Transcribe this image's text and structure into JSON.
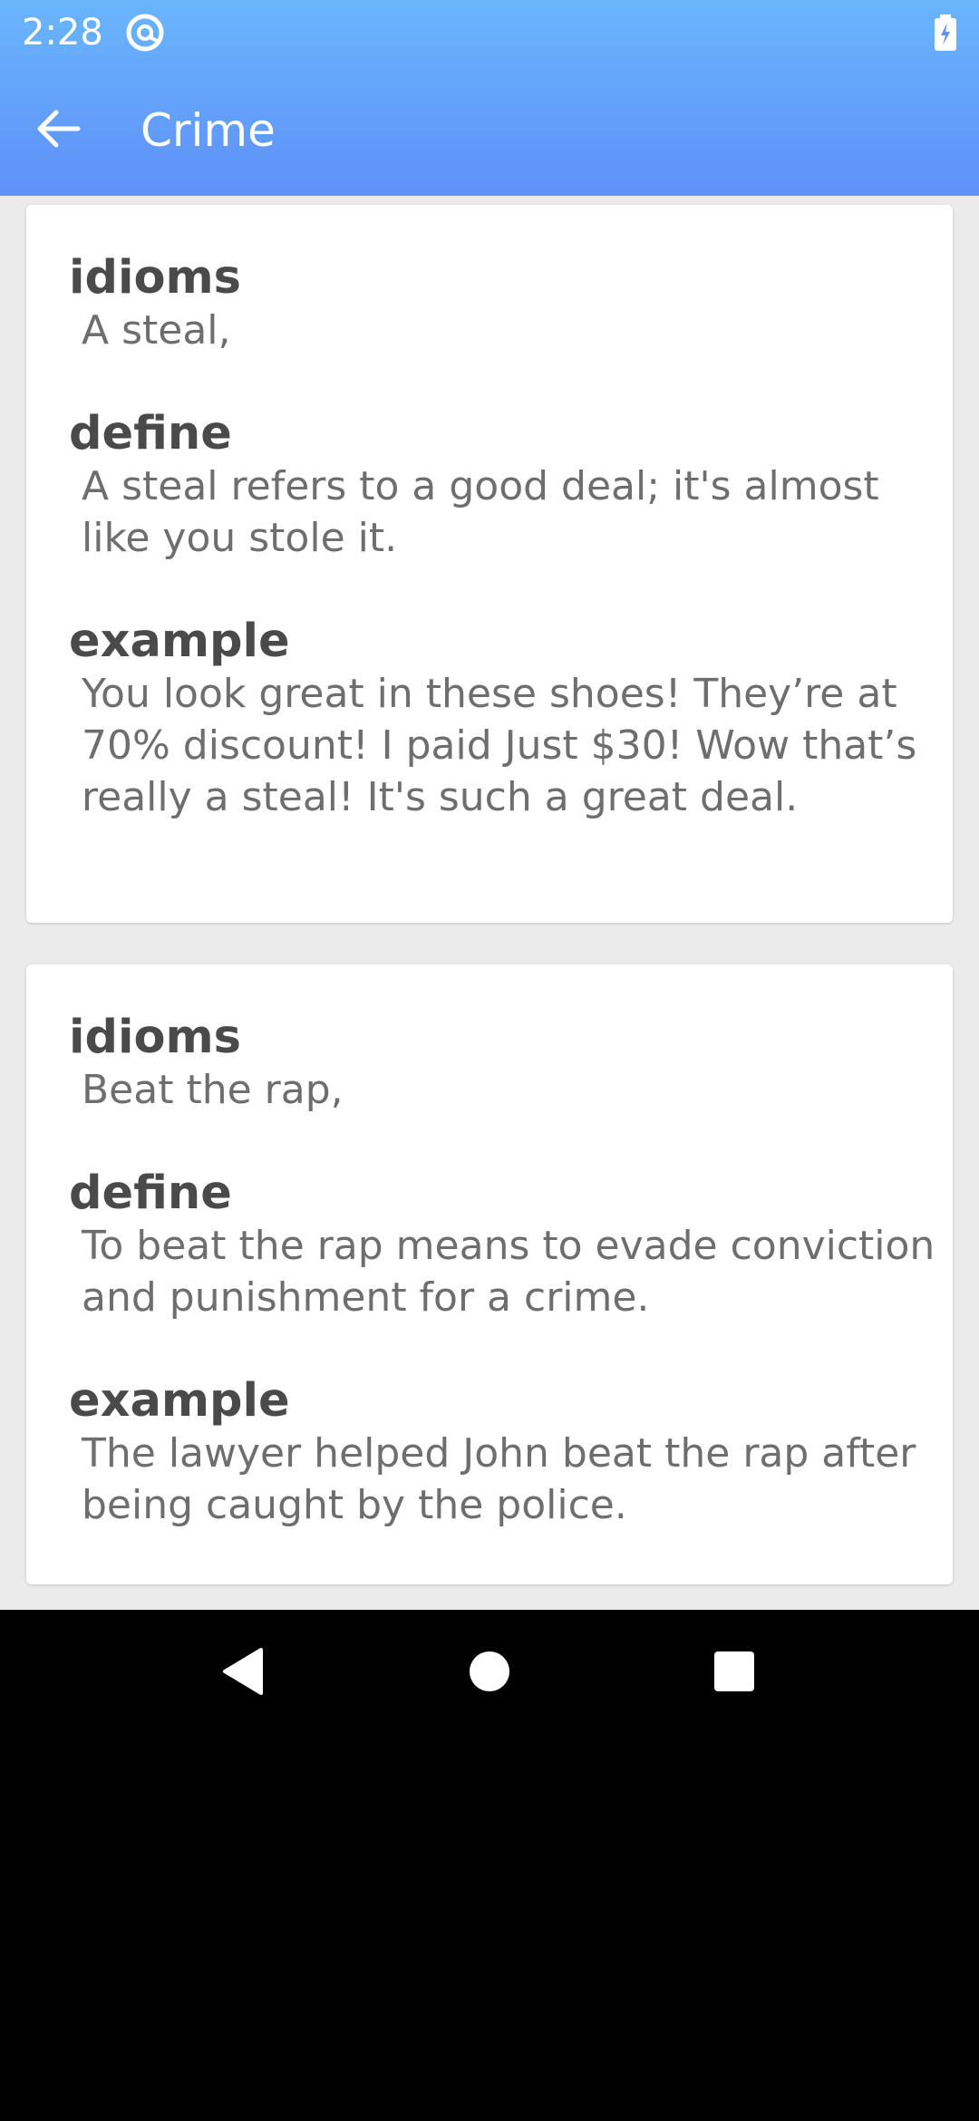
{
  "status_bar": {
    "time": "2:28",
    "app_icon": "at-sign-icon",
    "battery_icon": "battery-charging-icon"
  },
  "toolbar": {
    "title": "Crime",
    "back_icon": "arrow-left-icon"
  },
  "cards": [
    {
      "idioms_label": "idioms",
      "idioms_value": "A steal,",
      "define_label": "define",
      "define_value": "A steal refers to a good deal; it's almost like you stole it.",
      "example_label": "example",
      "example_value": "You look great in these shoes! They’re at 70% discount! I paid Just $30! Wow that’s really a steal! It's such a great deal."
    },
    {
      "idioms_label": "idioms",
      "idioms_value": "Beat the rap,",
      "define_label": "define",
      "define_value": "To beat the rap means to evade conviction and punishment for a crime.",
      "example_label": "example",
      "example_value": "The lawyer helped John beat the rap after being caught by the police."
    }
  ],
  "nav_bar": {
    "back_icon": "triangle-back-icon",
    "home_icon": "circle-home-icon",
    "recents_icon": "square-recents-icon"
  },
  "colors": {
    "header_gradient_top": "#69b6fc",
    "header_gradient_bottom": "#5e90f8",
    "background": "#ebebeb",
    "label_text": "#4a4a4a",
    "value_text": "#6e6e6e"
  }
}
